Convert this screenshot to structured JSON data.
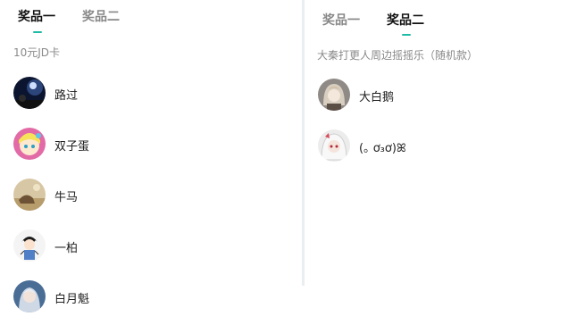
{
  "left": {
    "tabs": [
      {
        "label": "奖品一",
        "active": true
      },
      {
        "label": "奖品二",
        "active": false
      }
    ],
    "prize": "10元JD卡",
    "winners": [
      {
        "name": "路过",
        "avatar_icon": "dark-blue-avatar-icon"
      },
      {
        "name": "双子蛋",
        "avatar_icon": "anime-pink-avatar-icon"
      },
      {
        "name": "牛马",
        "avatar_icon": "sepia-scene-avatar-icon"
      },
      {
        "name": "一柏",
        "avatar_icon": "cartoon-boy-avatar-icon"
      },
      {
        "name": "白月魁",
        "avatar_icon": "blue-character-avatar-icon"
      }
    ]
  },
  "right": {
    "tabs": [
      {
        "label": "奖品一",
        "active": false
      },
      {
        "label": "奖品二",
        "active": true
      }
    ],
    "prize": "大秦打更人周边摇摇乐（随机款）",
    "winners": [
      {
        "name": "大白鹅",
        "avatar_icon": "anime-gray-avatar-icon"
      },
      {
        "name": "(｡ ơ₃ơ)ꕤ",
        "avatar_icon": "anime-white-hair-avatar-icon"
      }
    ]
  },
  "colors": {
    "accent": "#1fbba6",
    "divider": "#e9eef1"
  }
}
